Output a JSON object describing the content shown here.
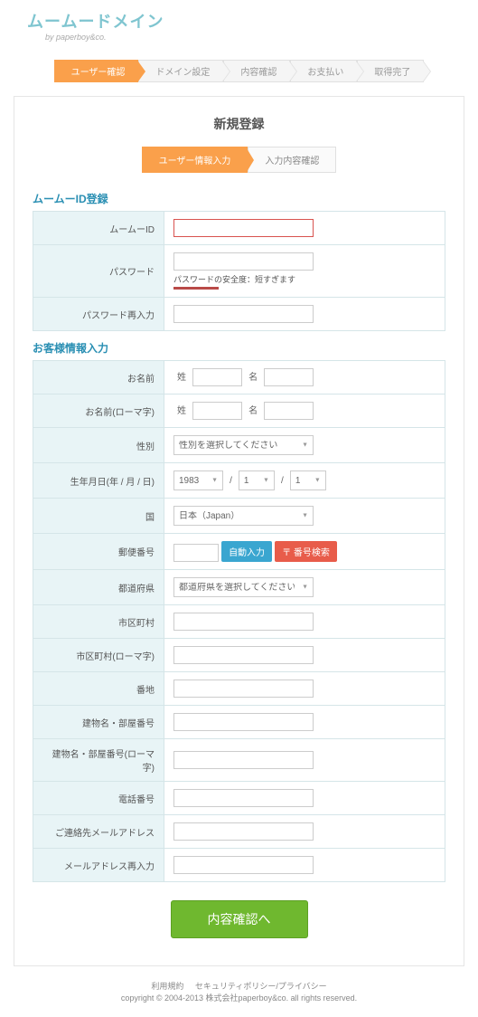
{
  "brand": {
    "name": "ムームードメイン",
    "byline": "by paperboy&co."
  },
  "steps": [
    "ユーザー確認",
    "ドメイン設定",
    "内容確認",
    "お支払い",
    "取得完了"
  ],
  "page_title": "新規登録",
  "sub_steps": [
    "ユーザー情報入力",
    "入力内容確認"
  ],
  "section1_title": "ムームーID登録",
  "section2_title": "お客様情報入力",
  "labels": {
    "muuid": "ムームーID",
    "password": "パスワード",
    "password_msg": "パスワードの安全度：短すぎます",
    "password2": "パスワード再入力",
    "name": "お名前",
    "name_roma": "お名前(ローマ字)",
    "sei": "姓",
    "mei": "名",
    "gender": "性別",
    "gender_placeholder": "性別を選択してください",
    "birth": "生年月日(年 / 月 / 日)",
    "birth_year": "1983",
    "birth_month": "1",
    "birth_day": "1",
    "country": "国",
    "country_val": "日本（Japan）",
    "postal": "郵便番号",
    "btn_auto": "自動入力",
    "btn_postal_search": "〒 番号検索",
    "pref": "都道府県",
    "pref_placeholder": "都道府県を選択してください",
    "city": "市区町村",
    "city_roma": "市区町村(ローマ字)",
    "addr": "番地",
    "bldg": "建物名・部屋番号",
    "bldg_roma": "建物名・部屋番号(ローマ字)",
    "tel": "電話番号",
    "email": "ご連絡先メールアドレス",
    "email2": "メールアドレス再入力"
  },
  "submit_label": "内容確認へ",
  "footer": {
    "links": [
      "利用規約",
      "セキュリティポリシー/プライバシー"
    ],
    "copyright": "copyright © 2004-2013 株式会社paperboy&co. all rights reserved."
  }
}
